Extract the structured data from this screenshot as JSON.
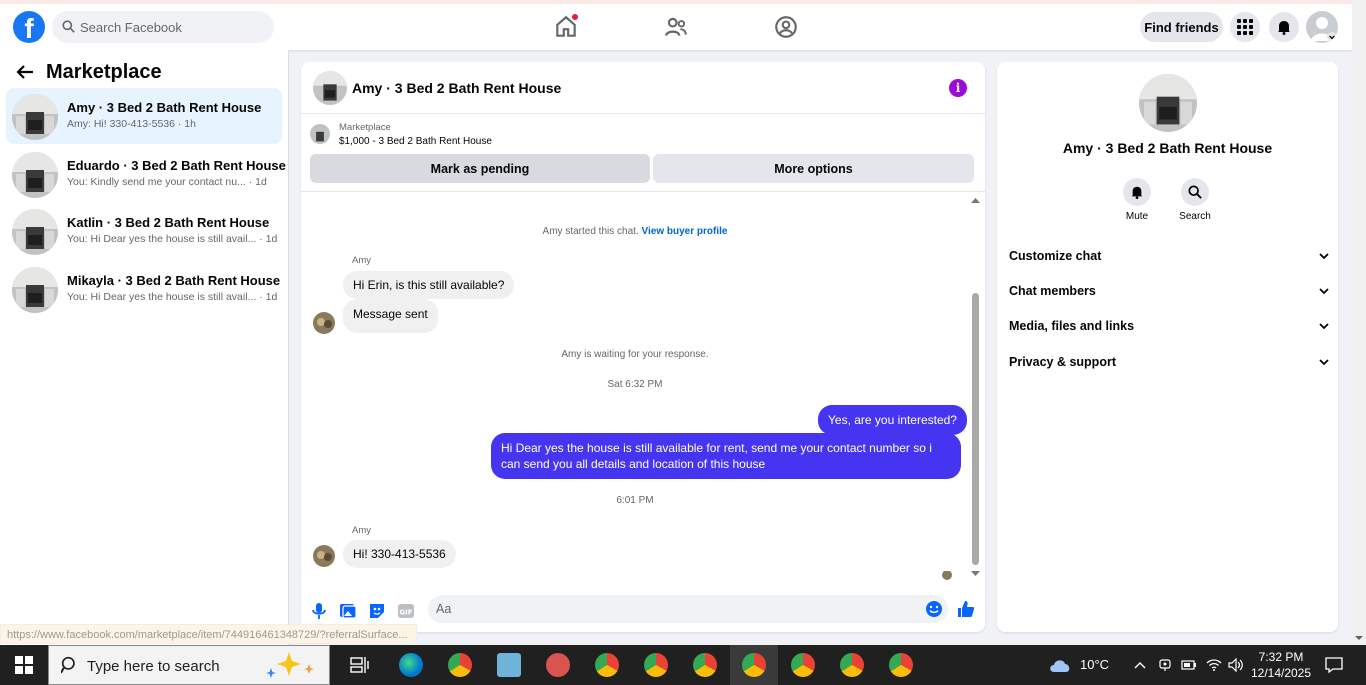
{
  "topnav": {
    "logo_letter": "f",
    "search_placeholder": "Search Facebook",
    "find_friends": "Find friends"
  },
  "sidebar": {
    "title": "Marketplace",
    "conversations": [
      {
        "name": "Amy · 3 Bed 2 Bath Rent House",
        "preview": "Amy: Hi! 330-413-5536 · 1h",
        "active": true
      },
      {
        "name": "Eduardo · 3 Bed 2 Bath Rent House",
        "preview": "You: Kindly send me your contact nu... · 1d"
      },
      {
        "name": "Katlin · 3 Bed 2 Bath Rent House",
        "preview": "You: Hi Dear yes the house is still avail... · 1d"
      },
      {
        "name": "Mikayla · 3 Bed 2 Bath Rent House",
        "preview": "You: Hi Dear yes the house is still avail... · 1d"
      }
    ]
  },
  "chat": {
    "title": "Amy · 3 Bed 2 Bath Rent House",
    "info_glyph": "i",
    "marketplace_label": "Marketplace",
    "listing": "$1,000 - 3 Bed 2 Bath Rent House",
    "mark_pending": "Mark as pending",
    "more_options": "More options",
    "started_text": "Amy started this chat.",
    "view_profile": "View buyer profile",
    "sender_name": "Amy",
    "msg1": "Hi Erin, is this still available?",
    "msg2": "Message sent",
    "waiting": "Amy is waiting for your response.",
    "time1": "Sat 6:32 PM",
    "out1": "Yes, are you interested?",
    "out2": "Hi Dear yes the house is still available for rent, send me your contact number so i can send you all details and location of this house",
    "time2": "6:01 PM",
    "sender_name2": "Amy",
    "msg3": "Hi! 330-413-5536",
    "composer_placeholder": "Aa"
  },
  "rpanel": {
    "name": "Amy · 3 Bed 2 Bath Rent House",
    "mute": "Mute",
    "search": "Search",
    "rows": [
      "Customize chat",
      "Chat members",
      "Media, files and links",
      "Privacy & support"
    ]
  },
  "status_url": "https://www.facebook.com/marketplace/item/744916461348729/?referralSurface...",
  "taskbar": {
    "search_placeholder": "Type here to search",
    "temp": "10°C",
    "time": "7:32 PM",
    "date": "12/14/2025"
  },
  "colors": {
    "brand": "#1877f2",
    "outgoing": "#4635f0",
    "info": "#9b0bd8",
    "active_conv": "#e7f3ff"
  }
}
